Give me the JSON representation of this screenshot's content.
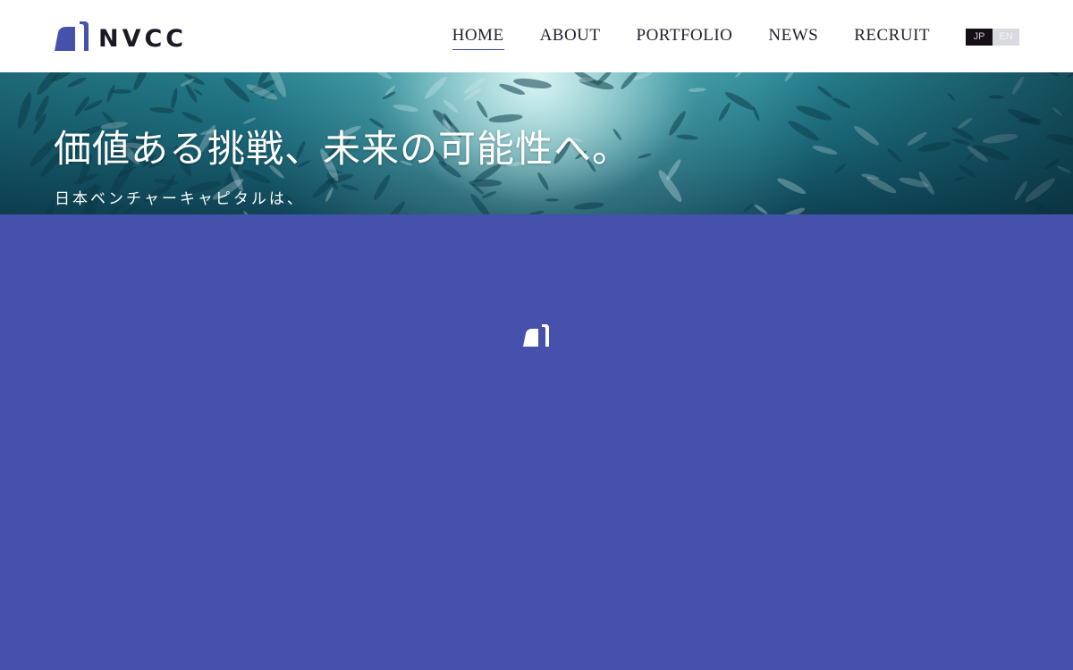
{
  "brand": {
    "name": "NVCC",
    "logo_icon": "nvcc-arch-mark-icon",
    "accent_color": "#4551ab"
  },
  "nav": {
    "items": [
      {
        "label": "HOME",
        "active": true
      },
      {
        "label": "ABOUT",
        "active": false
      },
      {
        "label": "PORTFOLIO",
        "active": false
      },
      {
        "label": "NEWS",
        "active": false
      },
      {
        "label": "RECRUIT",
        "active": false
      }
    ]
  },
  "language": {
    "options": [
      "JP",
      "EN"
    ],
    "selected": "JP"
  },
  "hero": {
    "title": "価値ある挑戦、未来の可能性へ。",
    "subtitle": "日本ベンチャーキャピタルは、"
  },
  "loader": {
    "background_color": "#4551ab",
    "icon": "nvcc-arch-mark-icon"
  }
}
